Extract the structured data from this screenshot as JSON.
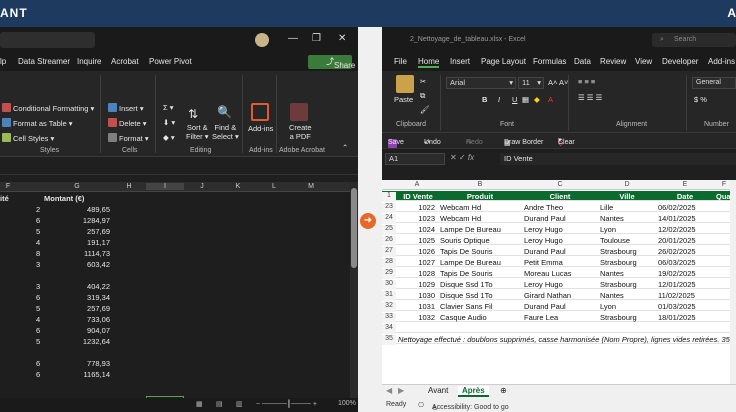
{
  "top": {
    "left_title": "ANT",
    "right_title": "A"
  },
  "left_window": {
    "menu": [
      "lp",
      "Data Streamer",
      "Inquire",
      "Acrobat",
      "Power Pivot"
    ],
    "share_label": "Share",
    "ribbon": {
      "styles_items": [
        "Conditional Formatting",
        "Format as Table",
        "Cell Styles"
      ],
      "styles_group": "Styles",
      "cells_items": [
        "Insert",
        "Delete",
        "Format"
      ],
      "cells_group": "Cells",
      "editing_items": [
        "Sort &",
        "Filter",
        "Find &",
        "Select"
      ],
      "editing_group": "Editing",
      "addins_label": "Add-ins",
      "addins_group": "Add-ins",
      "createpdf_label_1": "Create",
      "createpdf_label_2": "a PDF",
      "acrobat_group": "Adobe Acrobat"
    },
    "columns": [
      "F",
      "G",
      "H",
      "I",
      "J",
      "K",
      "L",
      "M"
    ],
    "header_row": {
      "qty": "ité",
      "amount": "Montant (€)"
    },
    "rows": [
      {
        "qty": "2",
        "amount": "489,65"
      },
      {
        "qty": "6",
        "amount": "1284,97"
      },
      {
        "qty": "5",
        "amount": "257,69"
      },
      {
        "qty": "4",
        "amount": "191,17"
      },
      {
        "qty": "8",
        "amount": "1114,73"
      },
      {
        "qty": "3",
        "amount": "603,42"
      },
      {
        "qty": "",
        "amount": ""
      },
      {
        "qty": "3",
        "amount": "404,22"
      },
      {
        "qty": "6",
        "amount": "319,34"
      },
      {
        "qty": "5",
        "amount": "257,69"
      },
      {
        "qty": "4",
        "amount": "733,06"
      },
      {
        "qty": "6",
        "amount": "904,07"
      },
      {
        "qty": "5",
        "amount": "1232,64"
      },
      {
        "qty": "",
        "amount": ""
      },
      {
        "qty": "6",
        "amount": "778,93"
      },
      {
        "qty": "6",
        "amount": "1165,14"
      }
    ],
    "zoom": "100%"
  },
  "right_window": {
    "title": "2_Nettoyage_de_tableau.xlsx - Excel",
    "search_placeholder": "Search",
    "menu": [
      "File",
      "Home",
      "Insert",
      "Page Layout",
      "Formulas",
      "Data",
      "Review",
      "View",
      "Developer",
      "Add-ins"
    ],
    "ribbon": {
      "paste": "Paste",
      "clipboard_group": "Clipboard",
      "font_name": "Arial",
      "font_size": "11",
      "font_group": "Font",
      "alignment_group": "Alignment",
      "number_format": "General",
      "number_group": "Number"
    },
    "qat": [
      "Save",
      "Undo",
      "Redo",
      "Draw Border",
      "Clear"
    ],
    "name_box": "A1",
    "formula": "ID Vente",
    "columns": [
      "A",
      "B",
      "C",
      "D",
      "E",
      "F"
    ],
    "header_row": {
      "num": "1",
      "cols": [
        "ID Vente",
        "Produit",
        "Client",
        "Ville",
        "Date",
        "Quan"
      ]
    },
    "rows": [
      {
        "num": "23",
        "id": "1022",
        "produit": "Webcam Hd",
        "client": "Andre Theo",
        "ville": "Lille",
        "date": "06/02/2025"
      },
      {
        "num": "24",
        "id": "1023",
        "produit": "Webcam Hd",
        "client": "Durand Paul",
        "ville": "Nantes",
        "date": "14/01/2025"
      },
      {
        "num": "25",
        "id": "1024",
        "produit": "Lampe De Bureau",
        "client": "Leroy Hugo",
        "ville": "Lyon",
        "date": "12/02/2025"
      },
      {
        "num": "26",
        "id": "1025",
        "produit": "Souris Optique",
        "client": "Leroy Hugo",
        "ville": "Toulouse",
        "date": "20/01/2025"
      },
      {
        "num": "27",
        "id": "1026",
        "produit": "Tapis De Souris",
        "client": "Durand Paul",
        "ville": "Strasbourg",
        "date": "26/02/2025"
      },
      {
        "num": "28",
        "id": "1027",
        "produit": "Lampe De Bureau",
        "client": "Petit Emma",
        "ville": "Strasbourg",
        "date": "06/03/2025"
      },
      {
        "num": "29",
        "id": "1028",
        "produit": "Tapis De Souris",
        "client": "Moreau Lucas",
        "ville": "Nantes",
        "date": "19/02/2025"
      },
      {
        "num": "30",
        "id": "1029",
        "produit": "Disque Ssd 1To",
        "client": "Leroy Hugo",
        "ville": "Strasbourg",
        "date": "12/01/2025"
      },
      {
        "num": "31",
        "id": "1030",
        "produit": "Disque Ssd 1To",
        "client": "Girard Nathan",
        "ville": "Nantes",
        "date": "11/02/2025"
      },
      {
        "num": "32",
        "id": "1031",
        "produit": "Clavier Sans Fil",
        "client": "Durand Paul",
        "ville": "Lyon",
        "date": "01/03/2025"
      },
      {
        "num": "33",
        "id": "1032",
        "produit": "Casque Audio",
        "client": "Faure Lea",
        "ville": "Strasbourg",
        "date": "18/01/2025"
      }
    ],
    "row34": "34",
    "row35": "35",
    "note": "Nettoyage effectué : doublons supprimés, casse harmonisée (Nom Propre), lignes vides retirées. 35 lignes brutes",
    "tabs": [
      "Avant",
      "Après"
    ],
    "status_ready": "Ready",
    "status_access": "Accessibility: Good to go"
  },
  "colors": {
    "banner": "#1e3a5f",
    "header_green": "#0b6b2e",
    "accent_orange": "#e8682a"
  }
}
